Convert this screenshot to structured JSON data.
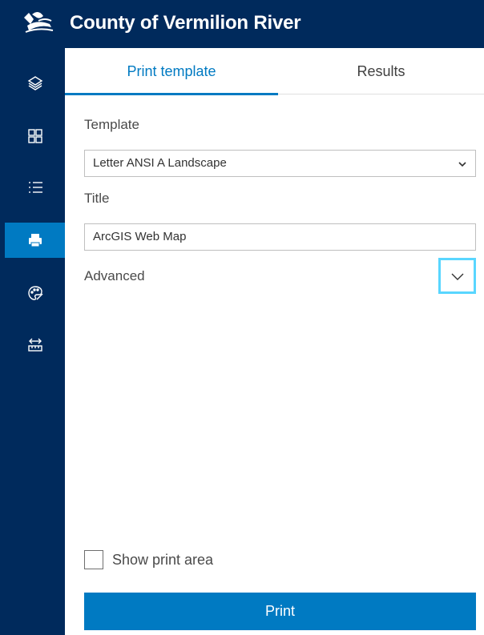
{
  "header": {
    "title": "County of Vermilion River",
    "logo_icon": "county-logo",
    "background": "#002a5c"
  },
  "sidebar": {
    "items": [
      {
        "name": "layers",
        "icon": "layers-icon"
      },
      {
        "name": "basemap-gallery",
        "icon": "grid-icon"
      },
      {
        "name": "legend",
        "icon": "list-icon"
      },
      {
        "name": "print",
        "icon": "printer-icon",
        "active": true
      },
      {
        "name": "sketch",
        "icon": "palette-icon"
      },
      {
        "name": "measurement",
        "icon": "ruler-icon"
      }
    ]
  },
  "tabs": [
    {
      "label": "Print template",
      "active": true
    },
    {
      "label": "Results",
      "active": false
    }
  ],
  "form": {
    "template_label": "Template",
    "template_value": "Letter ANSI A Landscape",
    "title_label": "Title",
    "title_value": "ArcGIS Web Map",
    "advanced_label": "Advanced",
    "show_print_area_label": "Show print area",
    "show_print_area_checked": false,
    "print_button_label": "Print"
  },
  "colors": {
    "accent": "#007ac2",
    "focus_ring": "#59d6ff"
  }
}
